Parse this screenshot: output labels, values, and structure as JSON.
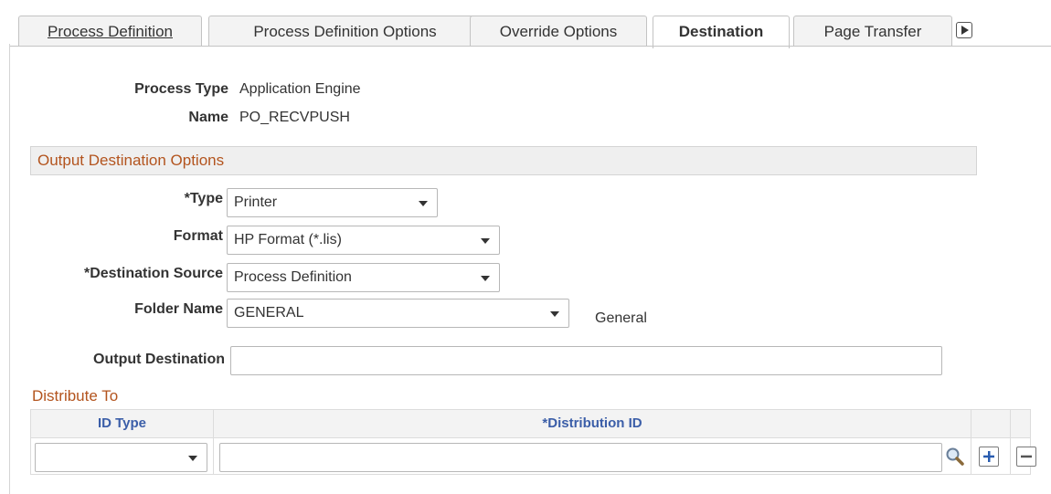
{
  "tabs": [
    {
      "label": "Process Definition",
      "active": false
    },
    {
      "label": "Process Definition Options",
      "active": false
    },
    {
      "label": "Override Options",
      "active": false
    },
    {
      "label": "Destination",
      "active": true
    },
    {
      "label": "Page Transfer",
      "active": false
    }
  ],
  "tabs_more_icon": "right-arrow-icon",
  "process": {
    "type_label": "Process Type",
    "type_value": "Application Engine",
    "name_label": "Name",
    "name_value": "PO_RECVPUSH"
  },
  "output_options": {
    "header": "Output Destination Options",
    "type_label": "*Type",
    "type_value": "Printer",
    "format_label": "Format",
    "format_value": "HP Format (*.lis)",
    "dest_source_label": "*Destination Source",
    "dest_source_value": "Process Definition",
    "folder_label": "Folder Name",
    "folder_value": "GENERAL",
    "folder_desc": "General",
    "output_dest_label": "Output Destination",
    "output_dest_value": ""
  },
  "distribute": {
    "title": "Distribute To",
    "col_id_type": "ID Type",
    "col_dist_id": "*Distribution ID",
    "row_id_type": "",
    "row_dist_id": ""
  },
  "colors": {
    "section_text": "#b3541e",
    "grid_header_text": "#3b5ea8",
    "plus_icon": "#2a5db0"
  }
}
